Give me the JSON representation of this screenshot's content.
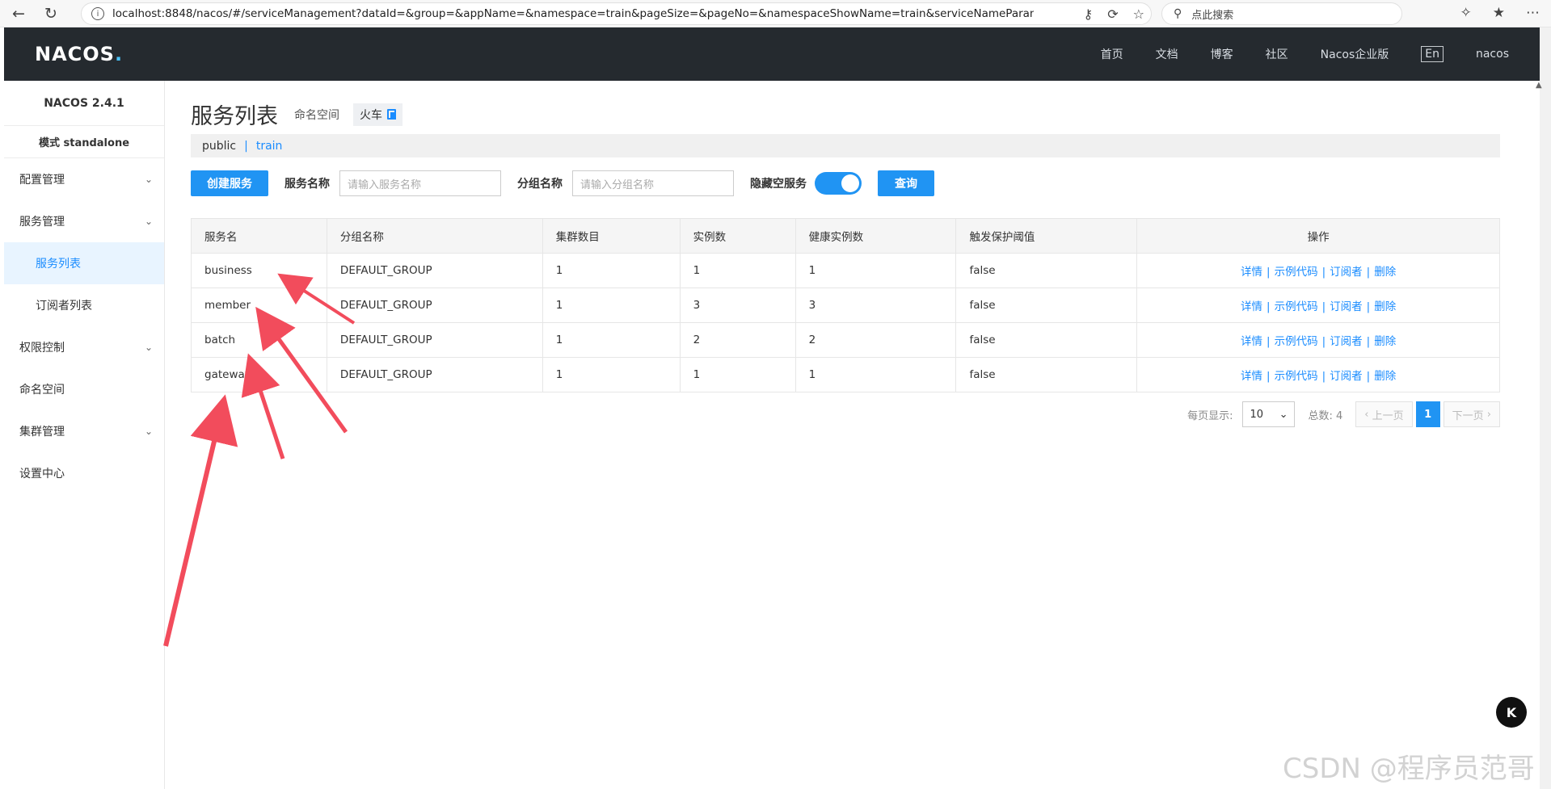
{
  "browser": {
    "url": "localhost:8848/nacos/#/serviceManagement?dataId=&group=&appName=&namespace=train&pageSize=&pageNo=&namespaceShowName=train&serviceNameParam=&groupNa...",
    "search_placeholder": "点此搜索"
  },
  "header": {
    "logo": "NACOS",
    "logo_dot": ".",
    "nav": [
      "首页",
      "文档",
      "博客",
      "社区",
      "Nacos企业版"
    ],
    "lang": "En",
    "user": "nacos"
  },
  "sidebar": {
    "version": "NACOS 2.4.1",
    "mode": "模式 standalone",
    "items": [
      {
        "label": "配置管理",
        "chevron": true
      },
      {
        "label": "服务管理",
        "chevron": true
      },
      {
        "label": "服务列表",
        "sub": true,
        "active": true
      },
      {
        "label": "订阅者列表",
        "sub": true
      },
      {
        "label": "权限控制",
        "chevron": true
      },
      {
        "label": "命名空间"
      },
      {
        "label": "集群管理",
        "chevron": true
      },
      {
        "label": "设置中心"
      }
    ]
  },
  "page": {
    "title": "服务列表",
    "ns_label": "命名空间",
    "ns_value": "火车",
    "ns_public": "public",
    "ns_sep": "|",
    "ns_train": "train"
  },
  "toolbar": {
    "create_label": "创建服务",
    "service_name_label": "服务名称",
    "service_name_placeholder": "请输入服务名称",
    "group_name_label": "分组名称",
    "group_name_placeholder": "请输入分组名称",
    "hide_empty_label": "隐藏空服务",
    "hide_empty_on": true,
    "query_label": "查询"
  },
  "table": {
    "headers": [
      "服务名",
      "分组名称",
      "集群数目",
      "实例数",
      "健康实例数",
      "触发保护阈值",
      "操作"
    ],
    "rows": [
      [
        "business",
        "DEFAULT_GROUP",
        "1",
        "1",
        "1",
        "false"
      ],
      [
        "member",
        "DEFAULT_GROUP",
        "1",
        "3",
        "3",
        "false"
      ],
      [
        "batch",
        "DEFAULT_GROUP",
        "1",
        "2",
        "2",
        "false"
      ],
      [
        "gateway",
        "DEFAULT_GROUP",
        "1",
        "1",
        "1",
        "false"
      ]
    ],
    "ops": [
      "详情",
      "示例代码",
      "订阅者",
      "删除"
    ]
  },
  "pager": {
    "per_page_label": "每页显示:",
    "page_size": "10",
    "total_label": "总数: 4",
    "prev": "上一页",
    "current": "1",
    "next": "下一页"
  },
  "watermark": "CSDN @程序员范哥",
  "colors": {
    "accent": "#2094f3",
    "header_bg": "#252a2f",
    "annotation_arrow": "#f24c5c"
  }
}
